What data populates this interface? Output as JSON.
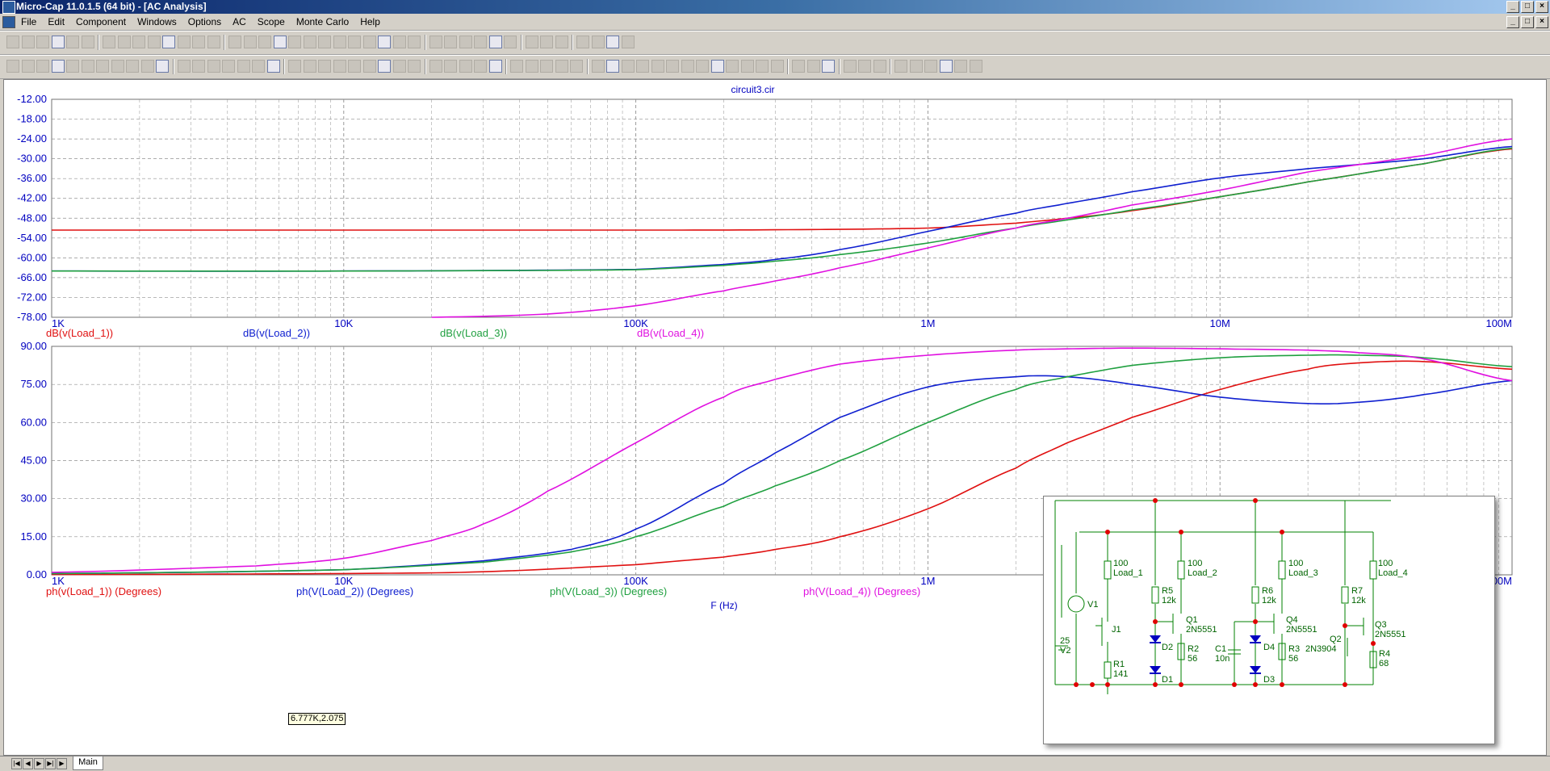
{
  "window": {
    "title": "Micro-Cap 11.0.1.5 (64 bit) - [AC Analysis]"
  },
  "menu": [
    "File",
    "Edit",
    "Component",
    "Windows",
    "Options",
    "AC",
    "Scope",
    "Monte Carlo",
    "Help"
  ],
  "tab": {
    "label": "Main"
  },
  "cursor_tip": "6.777K,2.075",
  "colors": {
    "load1": "#e01010",
    "load2": "#1020d0",
    "load3": "#20a040",
    "load4": "#e010e0",
    "grid": "#909090",
    "axis_text": "#0000c0"
  },
  "chart_data": [
    {
      "type": "line",
      "title": "circuit3.cir",
      "xscale": "log",
      "xlim": [
        1000,
        100000000
      ],
      "xticks": [
        "1K",
        "10K",
        "100K",
        "1M",
        "10M",
        "100M"
      ],
      "ylim": [
        -78,
        -12
      ],
      "yticks": [
        "-12.00",
        "-18.00",
        "-24.00",
        "-30.00",
        "-36.00",
        "-42.00",
        "-48.00",
        "-54.00",
        "-60.00",
        "-66.00",
        "-72.00",
        "-78.00"
      ],
      "grid": true,
      "series": [
        {
          "name": "dB(v(Load_1))",
          "color": "#e01010",
          "x": [
            1000,
            10000,
            100000,
            300000,
            1000000,
            2000000,
            3000000,
            5000000,
            10000000,
            20000000,
            50000000,
            100000000
          ],
          "values": [
            -51.6,
            -51.6,
            -51.6,
            -51.5,
            -51,
            -49.5,
            -48,
            -45.7,
            -41.5,
            -37,
            -31.5,
            -27
          ]
        },
        {
          "name": "dB(v(Load_2))",
          "color": "#1020d0",
          "x": [
            1000,
            10000,
            100000,
            200000,
            300000,
            500000,
            1000000,
            2000000,
            3000000,
            5000000,
            10000000,
            20000000,
            50000000,
            100000000
          ],
          "values": [
            -64,
            -64,
            -63.5,
            -62,
            -60.5,
            -57.5,
            -52,
            -46.5,
            -43.5,
            -40,
            -35.8,
            -33,
            -30,
            -26.3
          ]
        },
        {
          "name": "dB(v(Load_3))",
          "color": "#20a040",
          "x": [
            1000,
            10000,
            100000,
            200000,
            300000,
            500000,
            1000000,
            2000000,
            3000000,
            5000000,
            10000000,
            20000000,
            50000000,
            100000000
          ],
          "values": [
            -64,
            -64,
            -63.6,
            -62.3,
            -61,
            -59,
            -55.5,
            -51,
            -48.5,
            -45.5,
            -41.5,
            -37,
            -31.5,
            -26.8
          ]
        },
        {
          "name": "dB(v(Load_4))",
          "color": "#e010e0",
          "x": [
            20000,
            50000,
            100000,
            200000,
            300000,
            500000,
            1000000,
            2000000,
            3000000,
            5000000,
            10000000,
            20000000,
            50000000,
            100000000
          ],
          "values": [
            -78,
            -77,
            -74.5,
            -70,
            -67,
            -63,
            -57,
            -51,
            -48,
            -44,
            -39.5,
            -34,
            -29,
            -24
          ]
        }
      ]
    },
    {
      "type": "line",
      "xscale": "log",
      "xlim": [
        1000,
        100000000
      ],
      "xticks": [
        "1K",
        "10K",
        "100K",
        "1M",
        "10M",
        "100M"
      ],
      "xlabel": "F (Hz)",
      "ylim": [
        0,
        90
      ],
      "yticks": [
        "90.00",
        "75.00",
        "60.00",
        "45.00",
        "30.00",
        "15.00",
        "0.00"
      ],
      "grid": true,
      "series": [
        {
          "name": "ph(v(Load_1)) (Degrees)",
          "color": "#e01010",
          "x": [
            1000,
            10000,
            30000,
            100000,
            200000,
            300000,
            500000,
            1000000,
            2000000,
            3000000,
            5000000,
            10000000,
            20000000,
            30000000,
            50000000,
            100000000
          ],
          "values": [
            0.1,
            0.5,
            1.2,
            4,
            7,
            10,
            15,
            26,
            42,
            52,
            62,
            73,
            81,
            83.5,
            84,
            81
          ]
        },
        {
          "name": "ph(V(Load_2)) (Degrees)",
          "color": "#1020d0",
          "x": [
            1000,
            10000,
            30000,
            60000,
            100000,
            200000,
            300000,
            500000,
            1000000,
            2000000,
            3000000,
            5000000,
            10000000,
            20000000,
            30000000,
            50000000,
            100000000
          ],
          "values": [
            0.5,
            2,
            5.5,
            10,
            18,
            36,
            48,
            62,
            74,
            78,
            78,
            75,
            70,
            67.5,
            68,
            71,
            76.5
          ]
        },
        {
          "name": "ph(V(Load_3)) (Degrees)",
          "color": "#20a040",
          "x": [
            1000,
            10000,
            30000,
            60000,
            100000,
            200000,
            300000,
            500000,
            1000000,
            2000000,
            3000000,
            5000000,
            10000000,
            20000000,
            30000000,
            50000000,
            100000000
          ],
          "values": [
            0.5,
            2,
            5,
            9,
            15,
            27,
            35,
            45,
            60,
            73,
            78,
            82.5,
            85.5,
            86.5,
            86.5,
            85.5,
            82
          ]
        },
        {
          "name": "ph(V(Load_4)) (Degrees)",
          "color": "#e010e0",
          "x": [
            1000,
            5000,
            10000,
            20000,
            30000,
            50000,
            100000,
            200000,
            300000,
            500000,
            1000000,
            2000000,
            3000000,
            5000000,
            10000000,
            20000000,
            30000000,
            50000000,
            100000000
          ],
          "values": [
            1,
            3.5,
            6.5,
            13.5,
            20,
            33,
            52,
            70,
            77,
            83,
            86.5,
            88.5,
            89,
            89.3,
            89,
            88.5,
            87.5,
            85,
            76.5
          ]
        }
      ]
    }
  ],
  "schematic": {
    "labels": {
      "v1": "V1",
      "v2_value": "25",
      "v2_name": "V2",
      "j1": "J1",
      "r1_name": "R1",
      "r1_value": "141",
      "load1_value": "100",
      "load1_name": "Load_1",
      "r5_name": "R5",
      "r5_value": "12k",
      "q1_name": "Q1",
      "q1_model": "2N5551",
      "d2": "D2",
      "d1": "D1",
      "r2_name": "R2",
      "r2_value": "56",
      "load2_value": "100",
      "load2_name": "Load_2",
      "c1_name": "C1",
      "c1_value": "10n",
      "r6_name": "R6",
      "r6_value": "12k",
      "d4": "D4",
      "d3": "D3",
      "q4_name": "Q4",
      "q4_model": "2N5551",
      "r3_name": "R3",
      "r3_value": "56",
      "load3_value": "100",
      "load3_name": "Load_3",
      "r7_name": "R7",
      "r7_value": "12k",
      "q2_name": "Q2",
      "q2_model": "2N3904",
      "q3_name": "Q3",
      "q3_model": "2N5551",
      "r4_name": "R4",
      "r4_value": "68",
      "load4_value": "100",
      "load4_name": "Load_4"
    }
  }
}
